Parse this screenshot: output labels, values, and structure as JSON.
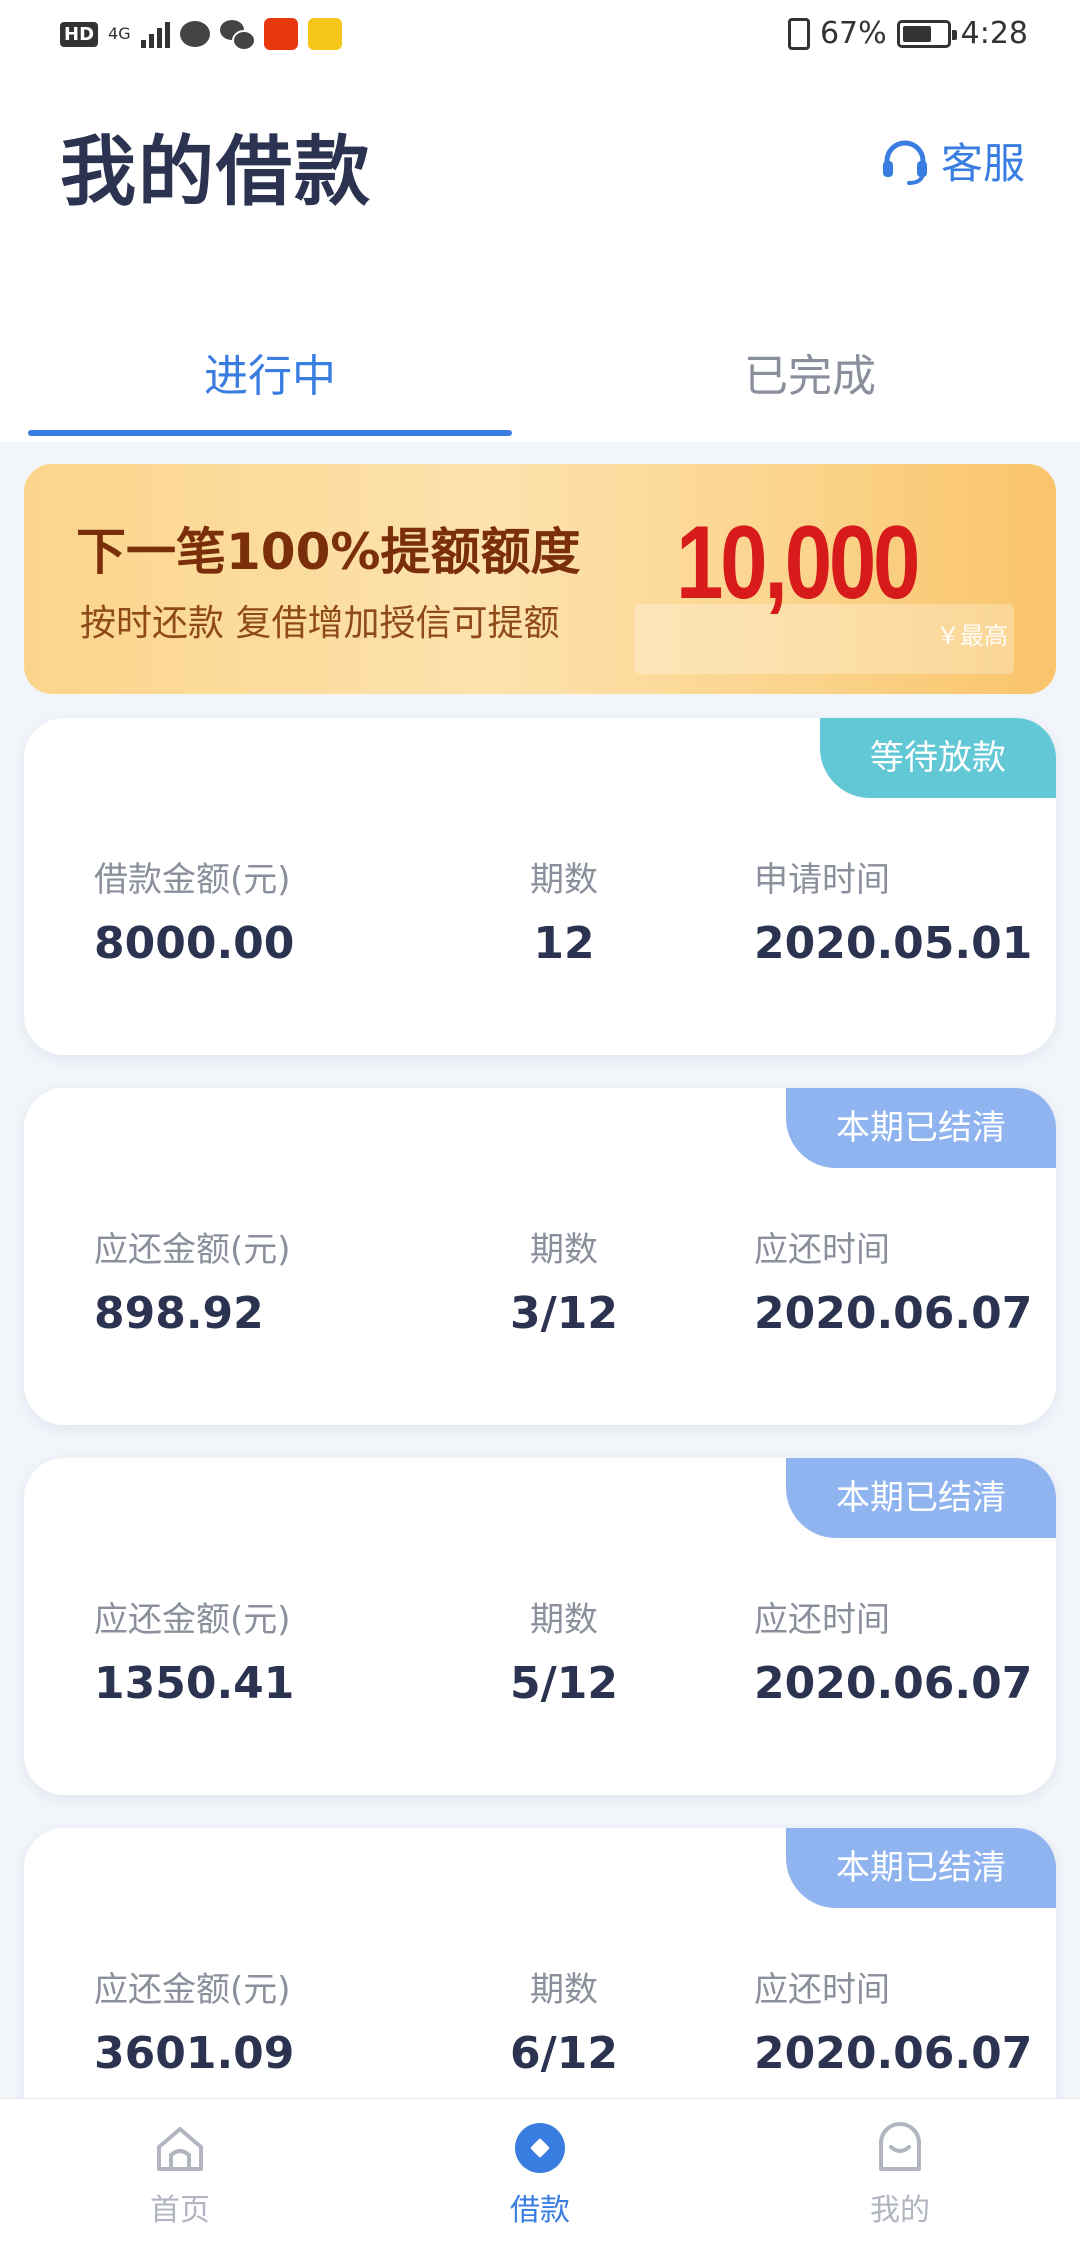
{
  "status_bar": {
    "hd": "HD",
    "network": "4G",
    "battery": "67%",
    "battery_level": 0.67,
    "time": "4:28",
    "app_icons": [
      "message-icon",
      "wechat-icon",
      "app-icon",
      "app-icon"
    ]
  },
  "header": {
    "title": "我的借款",
    "service_label": "客服"
  },
  "tabs": [
    {
      "label": "进行中",
      "active": true
    },
    {
      "label": "已完成",
      "active": false
    }
  ],
  "banner": {
    "headline": "下一笔100%提额额度",
    "subline": "按时还款  复借增加授信可提额",
    "amount": "10,000",
    "note": "￥最高"
  },
  "loans": [
    {
      "tag": "等待放款",
      "tag_color": "#62c8d6",
      "col1_label": "借款金额(元)",
      "col1_value": "8000.00",
      "col2_label": "期数",
      "col2_value": "12",
      "col3_label": "申请时间",
      "col3_value": "2020.05.01"
    },
    {
      "tag": "本期已结清",
      "tag_color": "#8fb4f0",
      "col1_label": "应还金额(元)",
      "col1_value": "898.92",
      "col2_label": "期数",
      "col2_value": "3/12",
      "col3_label": "应还时间",
      "col3_value": "2020.06.07"
    },
    {
      "tag": "本期已结清",
      "tag_color": "#8fb4f0",
      "col1_label": "应还金额(元)",
      "col1_value": "1350.41",
      "col2_label": "期数",
      "col2_value": "5/12",
      "col3_label": "应还时间",
      "col3_value": "2020.06.07"
    },
    {
      "tag": "本期已结清",
      "tag_color": "#8fb4f0",
      "col1_label": "应还金额(元)",
      "col1_value": "3601.09",
      "col2_label": "期数",
      "col2_value": "6/12",
      "col3_label": "应还时间",
      "col3_value": "2020.06.07"
    }
  ],
  "bottom_nav": [
    {
      "label": "首页",
      "icon": "home-icon",
      "active": false
    },
    {
      "label": "借款",
      "icon": "loan-icon",
      "active": true
    },
    {
      "label": "我的",
      "icon": "profile-icon",
      "active": false
    }
  ],
  "colors": {
    "accent": "#3a7de0",
    "title": "#2b3350",
    "banner_amount": "#d71a1a",
    "tag_waiting": "#62c8d6",
    "tag_settled": "#8fb4f0"
  }
}
